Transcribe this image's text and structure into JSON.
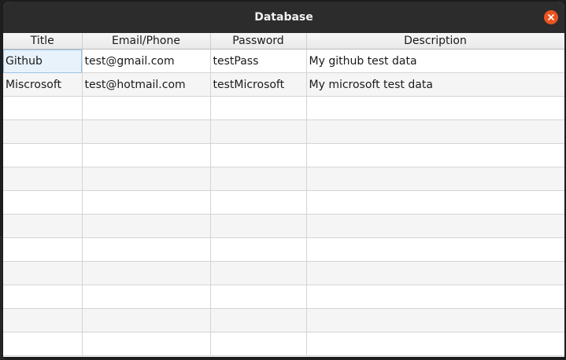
{
  "window": {
    "title": "Database"
  },
  "table": {
    "columns": [
      "Title",
      "Email/Phone",
      "Password",
      "Description"
    ],
    "rows": [
      [
        "Github",
        "test@gmail.com",
        "testPass",
        "My github test data"
      ],
      [
        "Miscrosoft",
        "test@hotmail.com",
        "testMicrosoft",
        "My microsoft test data"
      ],
      [
        "",
        "",
        "",
        ""
      ],
      [
        "",
        "",
        "",
        ""
      ],
      [
        "",
        "",
        "",
        ""
      ],
      [
        "",
        "",
        "",
        ""
      ],
      [
        "",
        "",
        "",
        ""
      ],
      [
        "",
        "",
        "",
        ""
      ],
      [
        "",
        "",
        "",
        ""
      ],
      [
        "",
        "",
        "",
        ""
      ],
      [
        "",
        "",
        "",
        ""
      ],
      [
        "",
        "",
        "",
        ""
      ],
      [
        "",
        "",
        "",
        ""
      ]
    ],
    "selected_cell": "Github"
  },
  "colors": {
    "close_button": "#e95420",
    "titlebar": "#2c2c2c",
    "selection": "#e8f2fb"
  }
}
